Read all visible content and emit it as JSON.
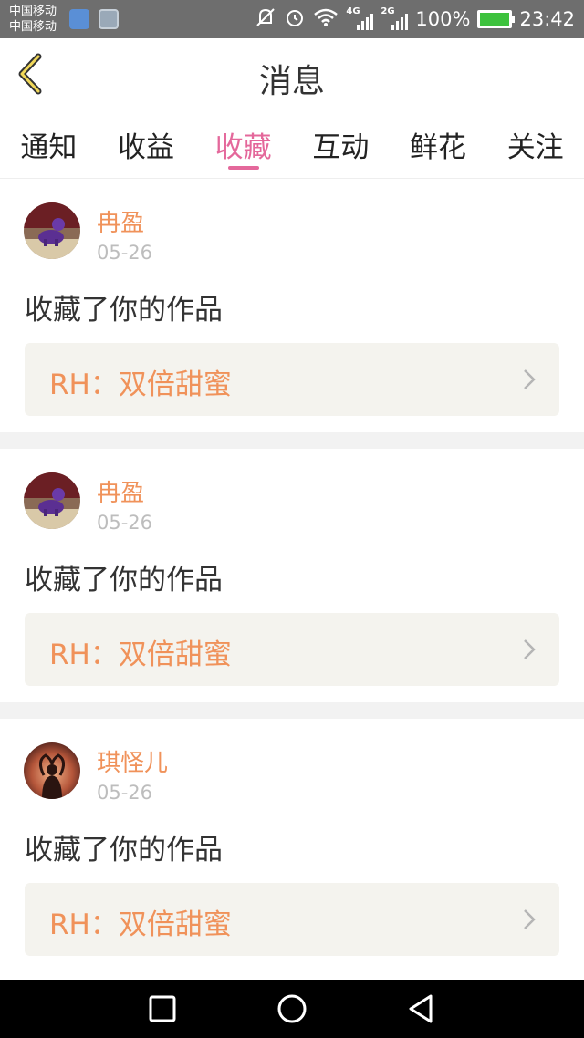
{
  "status_bar": {
    "carrier1": "中国移动",
    "carrier2": "中国移动",
    "net1": "4G",
    "net2": "2G",
    "battery_text": "100%",
    "time": "23:42"
  },
  "header": {
    "title": "消息"
  },
  "tabs": [
    {
      "label": "通知",
      "active": false
    },
    {
      "label": "收益",
      "active": false
    },
    {
      "label": "收藏",
      "active": true
    },
    {
      "label": "互动",
      "active": false
    },
    {
      "label": "鲜花",
      "active": false
    },
    {
      "label": "关注",
      "active": false
    }
  ],
  "messages": [
    {
      "user": "冉盈",
      "date": "05-26",
      "action": "收藏了你的作品",
      "work": "RH：双倍甜蜜",
      "avatar": "purple-plush-avatar"
    },
    {
      "user": "冉盈",
      "date": "05-26",
      "action": "收藏了你的作品",
      "work": "RH：双倍甜蜜",
      "avatar": "purple-plush-avatar"
    },
    {
      "user": "琪怪儿",
      "date": "05-26",
      "action": "收藏了你的作品",
      "work": "RH：双倍甜蜜",
      "avatar": "silhouette-heart-avatar"
    }
  ],
  "colors": {
    "accent": "#e4689b",
    "orange": "#f0925a",
    "card_bg": "#f4f3ee"
  }
}
